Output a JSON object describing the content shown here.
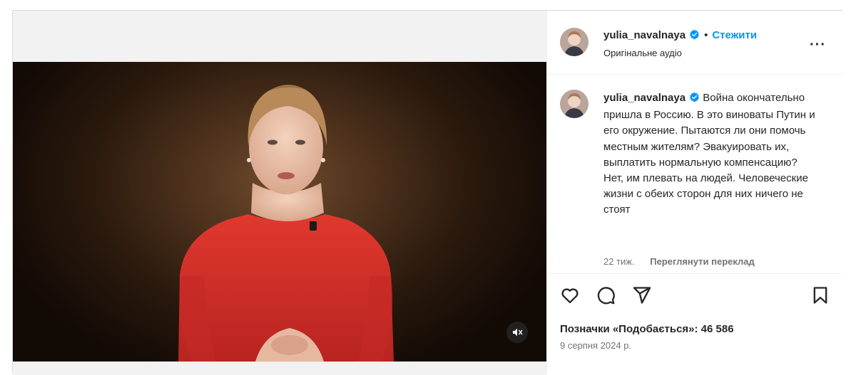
{
  "post": {
    "username": "yulia_navalnaya",
    "follow_label": "Стежити",
    "separator": "•",
    "audio_label": "Оригінальне аудіо",
    "caption": "Война окончательно пришла в Россию. В это виноваты Путин и его окружение. Пытаются ли они помочь местным жителям? Эвакуировать их, выплатить нормальную компенсацию? Нет, им плевать на людей. Человеческие жизни с обеих сторон для них ничего не стоят",
    "time_ago": "22 тиж.",
    "translate_label": "Переглянути переклад",
    "likes_text": "Позначки «Подобається»: 46 586",
    "date": "9 серпня 2024 р.",
    "more_label": "···"
  },
  "icons": {
    "verified": "verified-badge-icon",
    "like": "heart-icon",
    "comment": "comment-icon",
    "share": "paper-plane-icon",
    "save": "bookmark-icon",
    "mute": "muted-speaker-icon",
    "more": "more-options-icon"
  },
  "colors": {
    "accent": "#0095f6",
    "text": "#262626",
    "secondary_text": "#737373",
    "dress": "#d9302e",
    "background": "#ffffff"
  }
}
